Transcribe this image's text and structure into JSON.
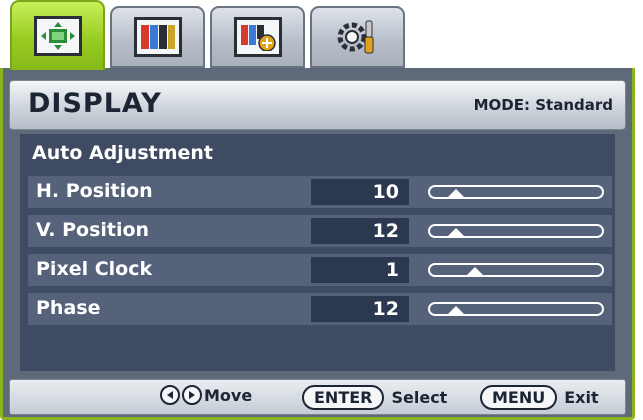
{
  "tabs": [
    {
      "icon": "display-arrows-icon",
      "active": true
    },
    {
      "icon": "picture-bars-icon",
      "active": false
    },
    {
      "icon": "picture-advanced-icon",
      "active": false
    },
    {
      "icon": "system-settings-icon",
      "active": false
    }
  ],
  "header": {
    "title": "DISPLAY",
    "mode": "MODE: Standard"
  },
  "menu": {
    "auto_adjustment": "Auto Adjustment",
    "rows": [
      {
        "label": "H. Position",
        "value": "10",
        "level": 0.15
      },
      {
        "label": "V. Position",
        "value": "12",
        "level": 0.15
      },
      {
        "label": "Pixel Clock",
        "value": "1",
        "level": 0.26
      },
      {
        "label": "Phase",
        "value": "12",
        "level": 0.15
      }
    ]
  },
  "footer": {
    "move_label": "Move",
    "enter_key": "ENTER",
    "select_label": "Select",
    "menu_key": "MENU",
    "exit_label": "Exit"
  },
  "colors": {
    "active_tab": "#99cc22",
    "panel": "#5e6a79",
    "content": "#3f4b62",
    "row": "#56627a"
  }
}
